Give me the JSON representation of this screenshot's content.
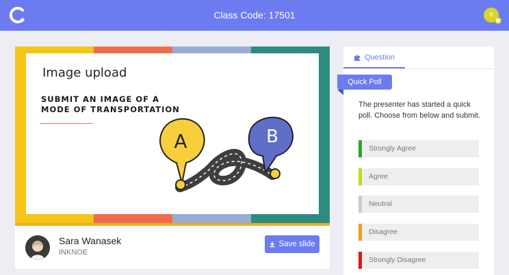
{
  "header": {
    "class_code": "Class Code: 17501",
    "avatar_initial": "S",
    "logo_icon": "logo-c-icon"
  },
  "slide": {
    "title": "Image upload",
    "subtitle_line1": "SUBMIT AN IMAGE OF A",
    "subtitle_line2": "MODE OF TRANSPORTATION",
    "bubble_a": "A",
    "bubble_b": "B",
    "stripe_colors": [
      "#f5c518",
      "#ef6d4e",
      "#96aed6",
      "#2e8b80"
    ]
  },
  "presenter": {
    "name": "Sara Wanasek",
    "org": "INKNOE",
    "save_label": "Save slide"
  },
  "panel": {
    "tab_label": "Question",
    "ribbon_label": "Quick Poll",
    "prompt": "The presenter has started a quick poll. Choose from below and submit.",
    "options": [
      {
        "label": "Strongly Agree",
        "color": "#2aa52a"
      },
      {
        "label": "Agree",
        "color": "#b7e01a"
      },
      {
        "label": "Neutral",
        "color": "#cccccc"
      },
      {
        "label": "Disagree",
        "color": "#f29b16"
      },
      {
        "label": "Strongly Disagree",
        "color": "#e01818"
      }
    ]
  },
  "colors": {
    "accent": "#6c7cf0",
    "page_bg": "#eceef3"
  }
}
